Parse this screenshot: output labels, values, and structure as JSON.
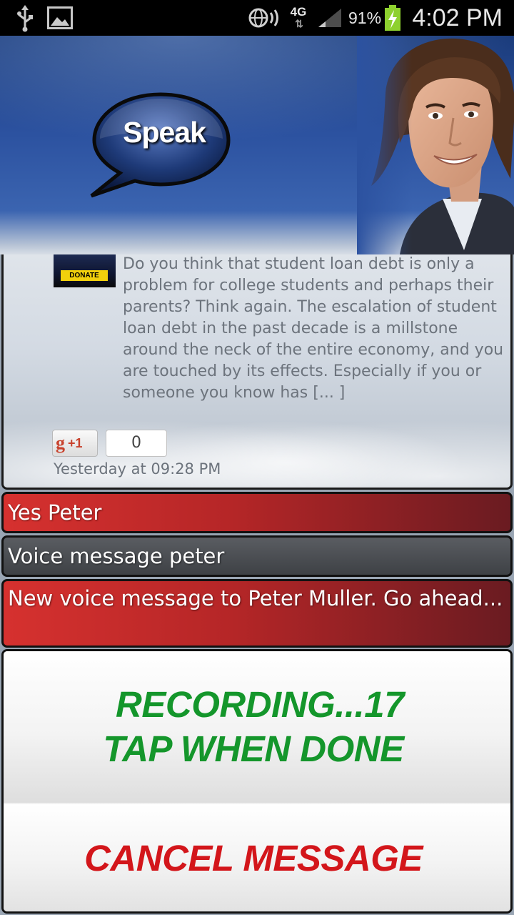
{
  "status_bar": {
    "icons_left": [
      "usb-icon",
      "image-icon"
    ],
    "icons_right": [
      "nfc-icon",
      "signal-icon",
      "battery-charging-icon"
    ],
    "network": "4G",
    "battery_percent": "91%",
    "time": "4:02 PM"
  },
  "header": {
    "logo_text": "Speak",
    "colors": {
      "banner": "#2c52a0",
      "bubble": "#1e3a78"
    }
  },
  "feed": {
    "thumb_badge": "DONATE",
    "post_text": "Do you think that student loan debt is only a problem for college students and perhaps their parents? Think again. The escalation of student loan debt in the past decade is a millstone around the neck of the entire economy, and you are touched by its effects. Especially if you or someone you know has [... ]",
    "gplus_label": "+1",
    "gplus_count": "0",
    "timestamp": "Yesterday at 09:28 PM"
  },
  "conversation": [
    {
      "text": "Yes Peter",
      "style": "red"
    },
    {
      "text": "Voice message peter",
      "style": "gray"
    },
    {
      "text": "New voice message to Peter Muller. Go ahead...",
      "style": "red"
    }
  ],
  "actions": {
    "record_line1": "RECORDING...17",
    "record_line2": "TAP WHEN DONE",
    "cancel_label": "CANCEL MESSAGE",
    "colors": {
      "record": "#14962b",
      "cancel": "#d3161b"
    }
  }
}
